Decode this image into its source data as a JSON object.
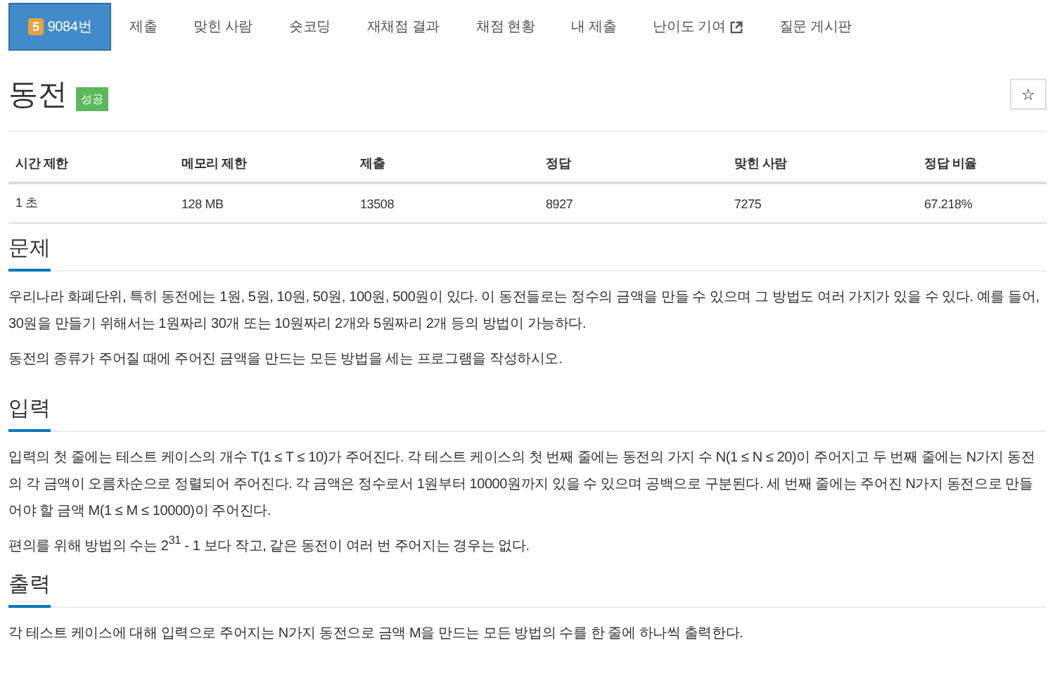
{
  "tabs": [
    {
      "label": "9084번",
      "badge": "5",
      "selected": true,
      "external": false
    },
    {
      "label": "제출",
      "selected": false,
      "external": false
    },
    {
      "label": "맞힌 사람",
      "selected": false,
      "external": false
    },
    {
      "label": "숏코딩",
      "selected": false,
      "external": false
    },
    {
      "label": "재채점 결과",
      "selected": false,
      "external": false
    },
    {
      "label": "채점 현황",
      "selected": false,
      "external": false
    },
    {
      "label": "내 제출",
      "selected": false,
      "external": false
    },
    {
      "label": "난이도 기여",
      "selected": false,
      "external": true
    },
    {
      "label": "질문 게시판",
      "selected": false,
      "external": false
    }
  ],
  "title": "동전",
  "status_label": "성공",
  "star_button": "☆",
  "table": {
    "columns": [
      "시간 제한",
      "메모리 제한",
      "제출",
      "정답",
      "맞힌 사람",
      "정답 비율"
    ],
    "rows": [
      [
        "1 초",
        "128 MB",
        "13508",
        "8927",
        "7275",
        "67.218%"
      ]
    ]
  },
  "sections": [
    {
      "heading": "문제",
      "paragraphs": [
        "우리나라 화폐단위, 특히 동전에는 1원, 5원, 10원, 50원, 100원, 500원이 있다. 이 동전들로는 정수의 금액을 만들 수 있으며 그 방법도 여러 가지가 있을 수 있다. 예를 들어, 30원을 만들기 위해서는 1원짜리 30개 또는 10원짜리 2개와 5원짜리 2개 등의 방법이 가능하다.",
        "동전의 종류가 주어질 때에 주어진 금액을 만드는 모든 방법을 세는 프로그램을 작성하시오."
      ]
    },
    {
      "heading": "입력",
      "paragraphs": [
        "입력의 첫 줄에는 테스트 케이스의 개수 T(1 ≤ T ≤ 10)가 주어진다. 각 테스트 케이스의 첫 번째 줄에는 동전의 가지 수 N(1 ≤ N ≤ 20)이 주어지고 두 번째 줄에는 N가지 동전의 각 금액이 오름차순으로 정렬되어 주어진다. 각 금액은 정수로서 1원부터 10000원까지 있을 수 있으며 공백으로 구분된다. 세 번째 줄에는 주어진 N가지 동전으로 만들어야 할 금액 M(1 ≤ M ≤ 10000)이 주어진다.",
        "편의를 위해 방법의 수는 2$^{31}$ - 1 보다 작고, 같은 동전이 여러 번 주어지는 경우는 없다."
      ]
    },
    {
      "heading": "출력",
      "paragraphs": [
        "각 테스트 케이스에 대해 입력으로 주어지는 N가지 동전으로 금액 M을 만드는 모든 방법의 수를 한 줄에 하나씩 출력한다."
      ]
    }
  ]
}
